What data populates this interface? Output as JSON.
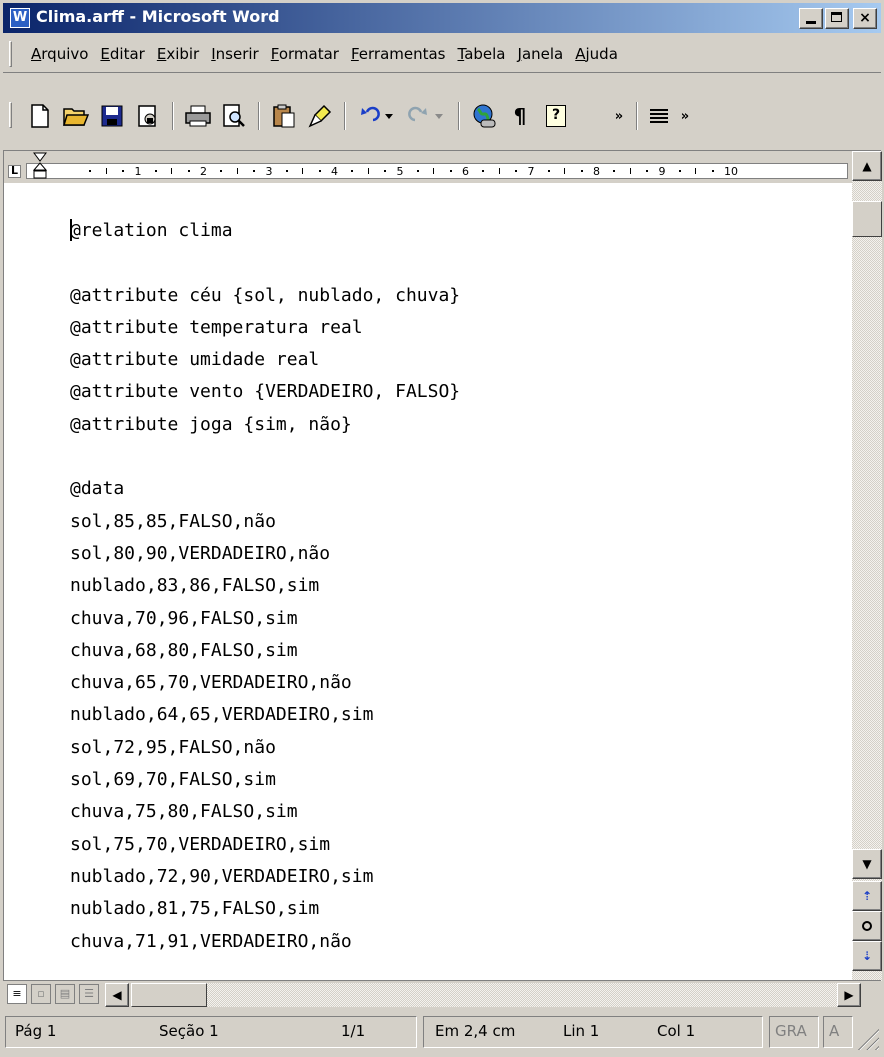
{
  "window": {
    "title": "Clima.arff - Microsoft Word",
    "app_icon": "W",
    "close_glyph": "×"
  },
  "menu": {
    "items": [
      "Arquivo",
      "Editar",
      "Exibir",
      "Inserir",
      "Formatar",
      "Ferramentas",
      "Tabela",
      "Janela",
      "Ajuda"
    ]
  },
  "toolbar": {
    "icons": [
      "new-document-icon",
      "open-folder-icon",
      "save-icon",
      "permission-icon",
      "print-icon",
      "print-preview-icon",
      "paste-icon",
      "format-painter-icon",
      "undo-icon",
      "redo-icon",
      "insert-hyperlink-icon",
      "show-formatting-icon",
      "help-icon",
      "align-icon"
    ],
    "pilcrow": "¶",
    "help": "?",
    "more": "»"
  },
  "ruler": {
    "tab_selector": "L",
    "numbers": [
      "1",
      "2",
      "3",
      "4",
      "5",
      "6",
      "7",
      "8",
      "9",
      "10"
    ]
  },
  "document": {
    "lines": [
      "@relation clima",
      "",
      "@attribute céu {sol, nublado, chuva}",
      "@attribute temperatura real",
      "@attribute umidade real",
      "@attribute vento {VERDADEIRO, FALSO}",
      "@attribute joga {sim, não}",
      "",
      "@data",
      "sol,85,85,FALSO,não",
      "sol,80,90,VERDADEIRO,não",
      "nublado,83,86,FALSO,sim",
      "chuva,70,96,FALSO,sim",
      "chuva,68,80,FALSO,sim",
      "chuva,65,70,VERDADEIRO,não",
      "nublado,64,65,VERDADEIRO,sim",
      "sol,72,95,FALSO,não",
      "sol,69,70,FALSO,sim",
      "chuva,75,80,FALSO,sim",
      "sol,75,70,VERDADEIRO,sim",
      "nublado,72,90,VERDADEIRO,sim",
      "nublado,81,75,FALSO,sim",
      "chuva,71,91,VERDADEIRO,não"
    ]
  },
  "statusbar": {
    "page": "Pág 1",
    "section": "Seção 1",
    "pages": "1/1",
    "at": "Em 2,4 cm",
    "line": "Lin 1",
    "col": "Col 1",
    "rec": "GRA",
    "ovr": "A"
  },
  "colors": {
    "title_start": "#0a246a",
    "title_end": "#a6caf0",
    "chrome": "#d4d0c8"
  }
}
